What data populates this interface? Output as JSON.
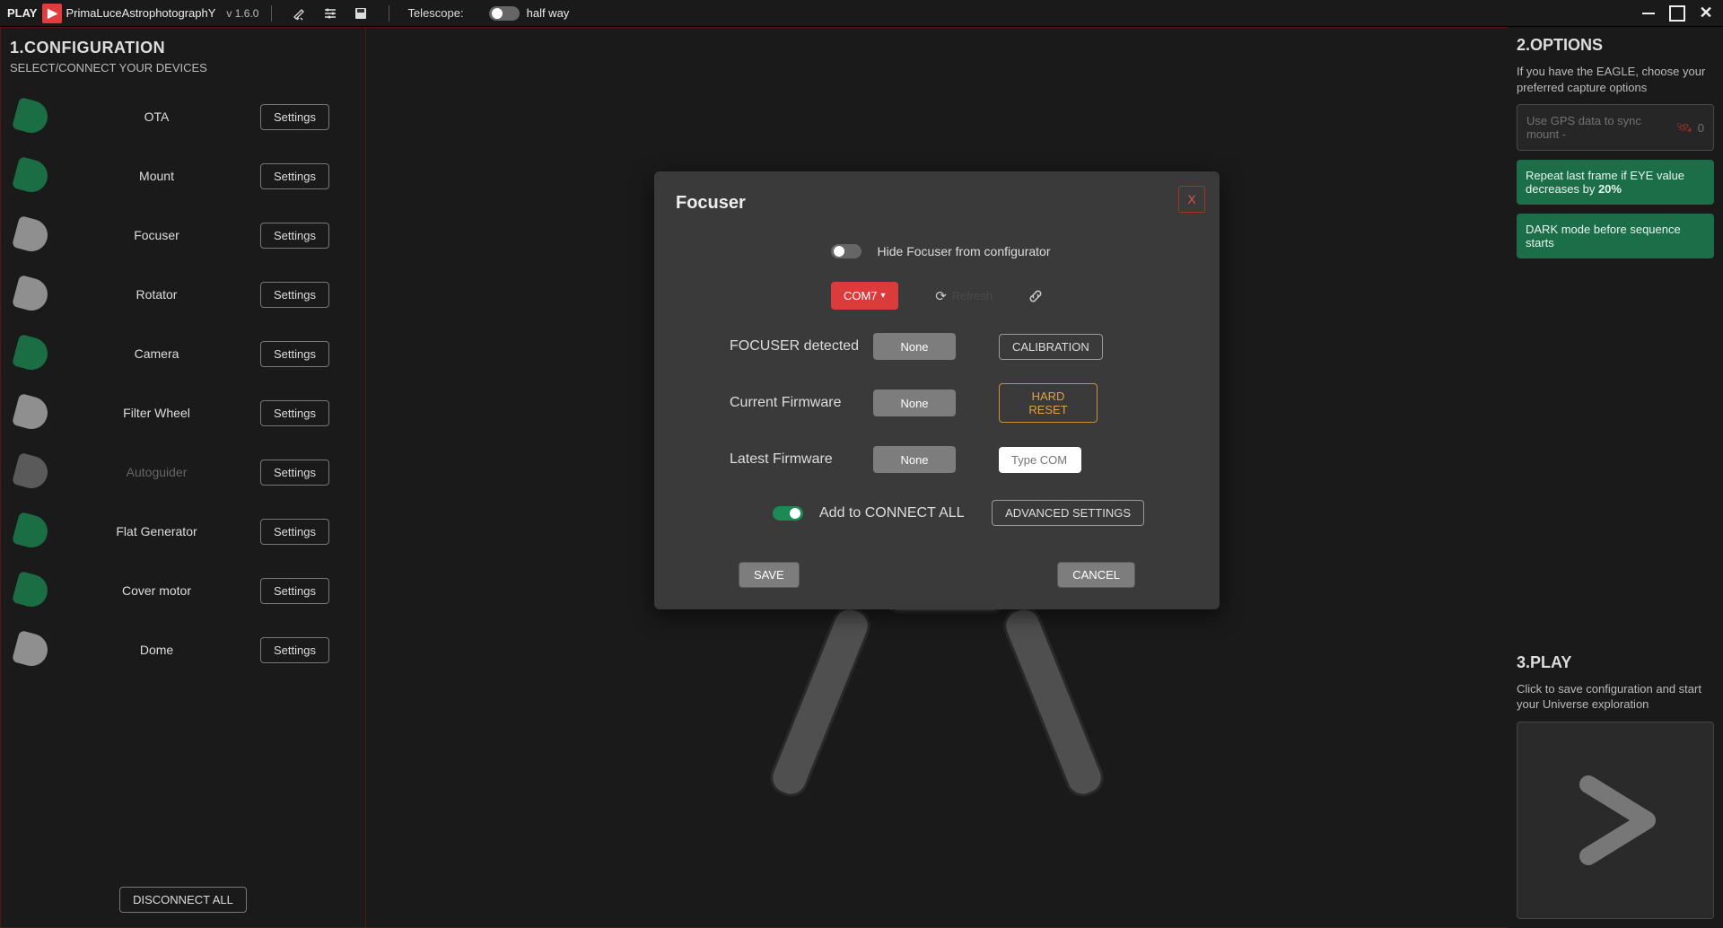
{
  "topbar": {
    "play": "PLAY",
    "brand": "PrimaLuceAstrophotographY",
    "version": "v 1.6.0",
    "telescope_label": "Telescope:",
    "telescope_status": "half way"
  },
  "sidebar": {
    "title": "1.CONFIGURATION",
    "subtitle": "SELECT/CONNECT YOUR DEVICES",
    "settings_label": "Settings",
    "disconnect_label": "DISCONNECT ALL",
    "devices": [
      {
        "name": "OTA",
        "tone": "green",
        "dim": false
      },
      {
        "name": "Mount",
        "tone": "green",
        "dim": false
      },
      {
        "name": "Focuser",
        "tone": "grey",
        "dim": false
      },
      {
        "name": "Rotator",
        "tone": "grey",
        "dim": false
      },
      {
        "name": "Camera",
        "tone": "green",
        "dim": false
      },
      {
        "name": "Filter Wheel",
        "tone": "grey",
        "dim": false
      },
      {
        "name": "Autoguider",
        "tone": "dark",
        "dim": true
      },
      {
        "name": "Flat Generator",
        "tone": "green",
        "dim": false
      },
      {
        "name": "Cover motor",
        "tone": "green",
        "dim": false
      },
      {
        "name": "Dome",
        "tone": "grey",
        "dim": false
      }
    ]
  },
  "options": {
    "title": "2.OPTIONS",
    "subtitle": "If you have the EAGLE, choose your preferred capture options",
    "gps_label": "Use GPS data to sync mount  -",
    "gps_badge": "0",
    "repeat_prefix": "Repeat last frame if EYE value decreases by ",
    "repeat_pct": "20%",
    "dark_label": "DARK mode before sequence starts"
  },
  "play": {
    "title": "3.PLAY",
    "subtitle": "Click to save configuration and start your Universe exploration"
  },
  "modal": {
    "title": "Focuser",
    "close": "X",
    "hide_label": "Hide Focuser from configurator",
    "port": "COM7",
    "refresh_label": "Refresh",
    "rows": {
      "detected_label": "FOCUSER detected",
      "detected_value": "None",
      "calibration": "CALIBRATION",
      "current_fw_label": "Current Firmware",
      "current_fw_value": "None",
      "hard_reset": "HARD RESET",
      "latest_fw_label": "Latest Firmware",
      "latest_fw_value": "None",
      "type_com": "Type COM"
    },
    "connect_all": "Add to CONNECT ALL",
    "advanced": "ADVANCED SETTINGS",
    "save": "SAVE",
    "cancel": "CANCEL"
  }
}
